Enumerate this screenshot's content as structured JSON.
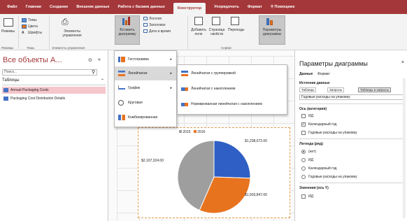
{
  "ribbon_tabs": [
    "Файл",
    "Главная",
    "Создание",
    "Внешние данные",
    "Работа с базами данных",
    "Конструктор",
    "Упорядочить",
    "Формат",
    "Помощник"
  ],
  "ribbon": {
    "views_label": "Режимы",
    "themes_label": "Темы",
    "colors_label": "Цвета",
    "fonts_label": "Шрифты",
    "themes_group": "Темы",
    "views_group": "Режимы",
    "elements_label": "Элементы управления",
    "elements_group": "Элементы управления",
    "insert_chart_label": "Вставить диаграмму",
    "logo_label": "Логотип",
    "title_label": "Заголовок",
    "datetime_label": "Дата и время",
    "add_field_label": "Добавить поле",
    "property_sheet_label": "Страница свойств",
    "tab_order_label": "Переходы",
    "service_group": "Сервис",
    "chart_settings_label": "Параметры диаграммы"
  },
  "nav": {
    "title": "Все объекты A...",
    "search_placeholder": "Поиск...",
    "section": "Таблицы",
    "items": [
      "Annual Packaging Costs",
      "Packaging Cost Distribution Details"
    ]
  },
  "chart_menu": {
    "items": [
      "Гистограмма",
      "Линейчатая",
      "График",
      "Круговая",
      "Комбинированная"
    ],
    "submenu": [
      "Линейчатая с группировкой",
      "Линейчатая с накоплением",
      "Нормированная линейчатая с накоплением"
    ]
  },
  "chart_data": {
    "type": "pie",
    "legend": [
      "2015",
      "2016"
    ],
    "slices": [
      {
        "label": "$1,238,072.00",
        "value": 1238072,
        "color": "#2f5fc4"
      },
      {
        "label": "$1,503,847.00",
        "value": 1503847,
        "color": "#e8731f"
      },
      {
        "label": "$2,107,324.00",
        "value": 2107324,
        "color": "#9e9e9e"
      }
    ],
    "legend_colors": [
      "#9e9e9e",
      "#e8731f"
    ]
  },
  "props": {
    "title": "Параметры диаграммы",
    "tab_data": "Данные",
    "tab_format": "Формат",
    "source_head": "Источник данных",
    "src_tables": "Таблицы",
    "src_queries": "Запросы",
    "src_both": "Таблицы и запросы",
    "source_value": "Годовые расходы на упаковку",
    "axis_head": "Ось (категория)",
    "axis_items": [
      {
        "label": "ИД",
        "checked": false
      },
      {
        "label": "Календарный год",
        "checked": true
      },
      {
        "label": "Годовые расходы на упаковку",
        "checked": false
      }
    ],
    "legend_head": "Легенда (ряд)",
    "legend_items": [
      {
        "label": "(нет)",
        "on": true
      },
      {
        "label": "ИД",
        "on": false
      },
      {
        "label": "Календарный год",
        "on": false
      },
      {
        "label": "Годовые расходы на упаковку",
        "on": false
      }
    ],
    "values_head": "Значения (ось Y)",
    "values_items": [
      {
        "label": "ИД",
        "checked": false
      }
    ]
  }
}
